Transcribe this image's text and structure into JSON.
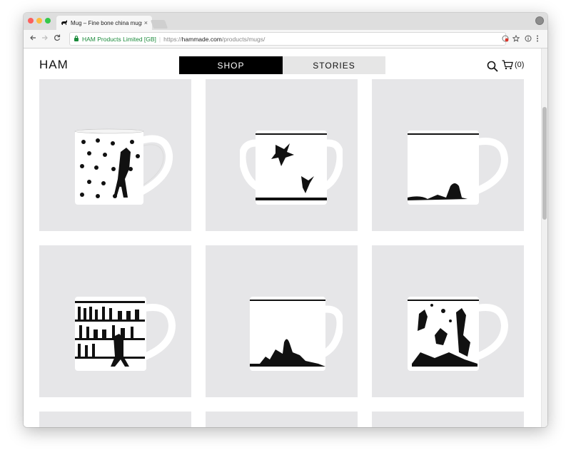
{
  "browser": {
    "tab_title": "Mug – Fine bone china mugs -",
    "tab_close": "×",
    "secure_label": "HAM Products Limited [GB]",
    "url_scheme": "https://",
    "url_host": "hammade.com",
    "url_path": "/products/mugs/"
  },
  "site": {
    "logo": "HAM",
    "nav": {
      "shop": "SHOP",
      "stories": "STORIES"
    },
    "cart_count": "(0)"
  },
  "products": [
    {
      "design": "flowers-ladder"
    },
    {
      "design": "hare-leap"
    },
    {
      "design": "hare-sitting"
    },
    {
      "design": "wine-bottles"
    },
    {
      "design": "hare-sandcastle"
    },
    {
      "design": "hare-circus"
    },
    {
      "design": "partial"
    },
    {
      "design": "partial"
    },
    {
      "design": "partial"
    }
  ]
}
